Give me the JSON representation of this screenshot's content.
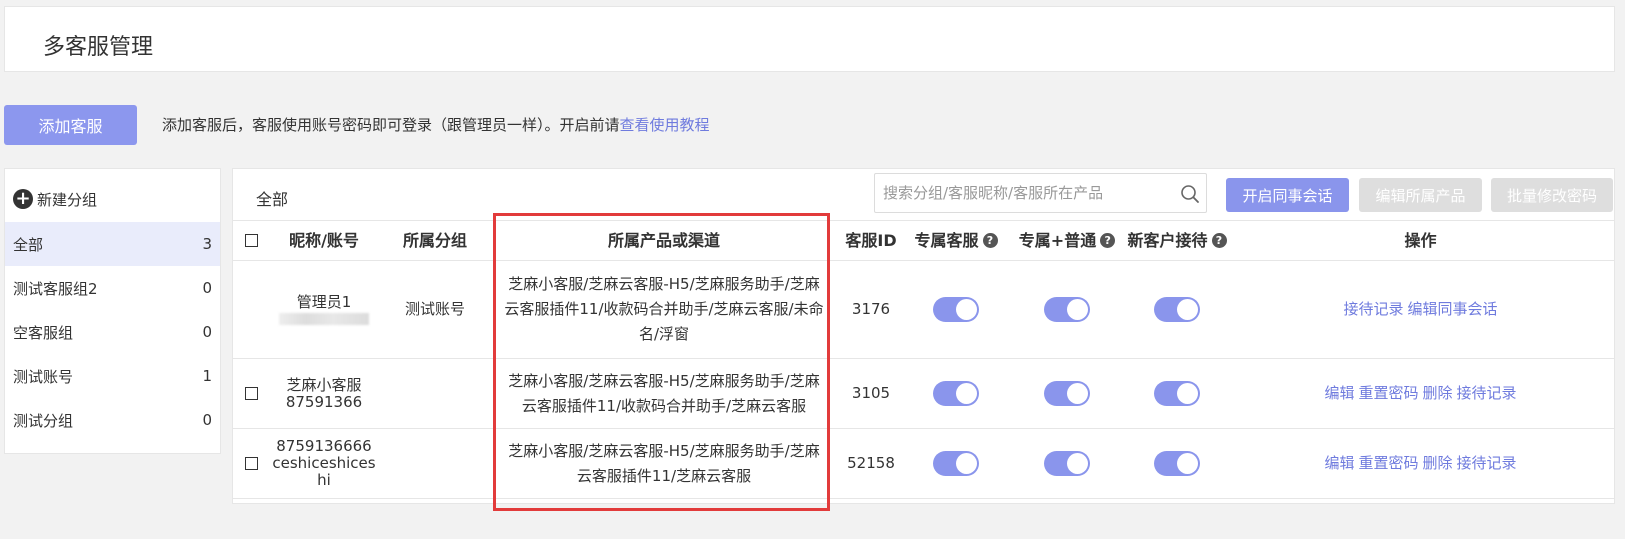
{
  "page_title": "多客服管理",
  "add_button": "添加客服",
  "notice": {
    "text": "添加客服后，客服使用账号密码即可登录（跟管理员一样）。开启前请",
    "link": "查看使用教程"
  },
  "sidebar": {
    "new_group": "新建分组",
    "groups": [
      {
        "label": "全部",
        "count": "3"
      },
      {
        "label": "测试客服组2",
        "count": "0"
      },
      {
        "label": "空客服组",
        "count": "0"
      },
      {
        "label": "测试账号",
        "count": "1"
      },
      {
        "label": "测试分组",
        "count": "0"
      }
    ]
  },
  "main": {
    "current_group": "全部",
    "search_placeholder": "搜索分组/客服昵称/客服所在产品",
    "buttons": {
      "colleague_chat": "开启同事会话",
      "edit_products": "编辑所属产品",
      "batch_password": "批量修改密码"
    },
    "headers": {
      "nickname": "昵称/账号",
      "group": "所属分组",
      "product": "所属产品或渠道",
      "id": "客服ID",
      "exclusive": "专属客服",
      "exclusive_plus": "专属+普通",
      "new_customer": "新客户接待",
      "ops": "操作"
    },
    "rows": [
      {
        "nickname": "管理员1",
        "group": "测试账号",
        "product": "芝麻小客服/芝麻云客服-H5/芝麻服务助手/芝麻云客服插件11/收款码合并助手/芝麻云客服/未命名/浮窗",
        "id": "3176",
        "exclusive_on": true,
        "exclusive_plus_on": true,
        "new_customer_on": true,
        "ops": [
          "接待记录",
          "编辑同事会话"
        ]
      },
      {
        "nickname": "芝麻小客服",
        "account": "87591366",
        "group": "",
        "product": "芝麻小客服/芝麻云客服-H5/芝麻服务助手/芝麻云客服插件11/收款码合并助手/芝麻云客服",
        "id": "3105",
        "exclusive_on": true,
        "exclusive_plus_on": true,
        "new_customer_on": true,
        "ops": [
          "编辑",
          "重置密码",
          "删除",
          "接待记录"
        ]
      },
      {
        "nickname": "8759136666",
        "account": "ceshiceshices",
        "account2": "hi",
        "group": "",
        "product": "芝麻小客服/芝麻云客服-H5/芝麻服务助手/芝麻云客服插件11/芝麻云客服",
        "id": "52158",
        "exclusive_on": true,
        "exclusive_plus_on": true,
        "new_customer_on": true,
        "ops": [
          "编辑",
          "重置密码",
          "删除",
          "接待记录"
        ]
      }
    ]
  },
  "colors": {
    "accent": "#8a95ec",
    "link": "#6f7bde",
    "highlight_border": "#e23b3b",
    "active_group_bg": "#e9ecfb"
  }
}
